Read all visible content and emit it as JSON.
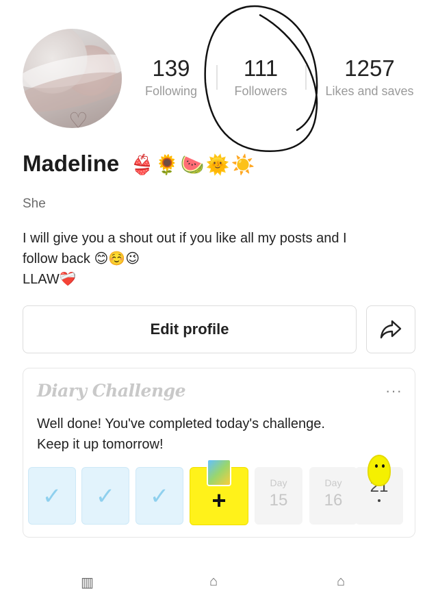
{
  "profile": {
    "name": "Madeline",
    "name_emojis": "👙🌻🍉🌞☀️",
    "pronoun": "She",
    "bio_lines": [
      "I will give you a shout out if you like all my posts and I",
      "follow back 😊☺️😉",
      "LLAW❤️‍🩹"
    ]
  },
  "stats": {
    "following": {
      "value": "139",
      "label": "Following"
    },
    "followers": {
      "value": "111",
      "label": "Followers"
    },
    "likes": {
      "value": "1257",
      "label": "Likes and saves"
    }
  },
  "actions": {
    "edit_profile": "Edit profile",
    "share_icon": "share-icon"
  },
  "challenge": {
    "title": "Diary Challenge",
    "message_line1": "Well done! You've completed today's challenge.",
    "message_line2": "Keep it up tomorrow!",
    "more_label": "···",
    "days": [
      {
        "state": "done",
        "mark": "✓"
      },
      {
        "state": "done",
        "mark": "✓"
      },
      {
        "state": "done",
        "mark": "✓"
      },
      {
        "state": "today",
        "mark": "+"
      },
      {
        "state": "future",
        "label": "Day",
        "number": "15"
      },
      {
        "state": "future",
        "label": "Day",
        "number": "16"
      },
      {
        "state": "future",
        "label": "",
        "number": "21"
      }
    ]
  },
  "colors": {
    "done_fill": "#e2f3fc",
    "today_fill": "#fff21a",
    "future_fill": "#f4f4f4"
  }
}
